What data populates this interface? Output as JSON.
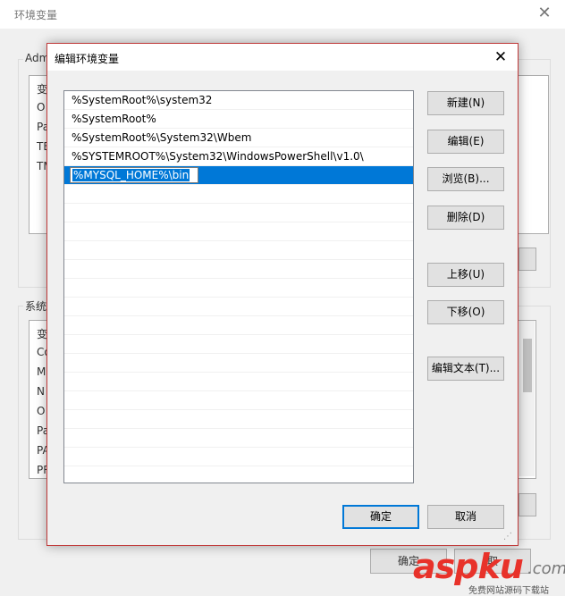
{
  "background_window": {
    "title": "环境变量",
    "user_group_label": "Adm",
    "user_list_rows": [
      "变",
      "O",
      "Pa",
      "TE",
      "TM"
    ],
    "system_group_label": "系统",
    "system_list_rows": [
      "变",
      "Co",
      "M",
      "N",
      "O",
      "Pa",
      "PA",
      "PR"
    ],
    "ok_label": "确定",
    "cancel_label": "取"
  },
  "dialog": {
    "title": "编辑环境变量",
    "paths": [
      "%SystemRoot%\\system32",
      "%SystemRoot%",
      "%SystemRoot%\\System32\\Wbem",
      "%SYSTEMROOT%\\System32\\WindowsPowerShell\\v1.0\\"
    ],
    "editing_value": "%MYSQL_HOME%\\bin",
    "buttons": {
      "new": "新建(N)",
      "edit": "编辑(E)",
      "browse": "浏览(B)...",
      "delete": "删除(D)",
      "move_up": "上移(U)",
      "move_down": "下移(O)",
      "edit_text": "编辑文本(T)...",
      "ok": "确定",
      "cancel": "取消"
    }
  },
  "watermark": {
    "brand": "aspku",
    "suffix": ".com",
    "tagline": "免费网站源码下载站"
  },
  "colors": {
    "selection": "#0078d7",
    "dialog_border": "#c03a3a",
    "watermark_red": "#e8322a"
  }
}
